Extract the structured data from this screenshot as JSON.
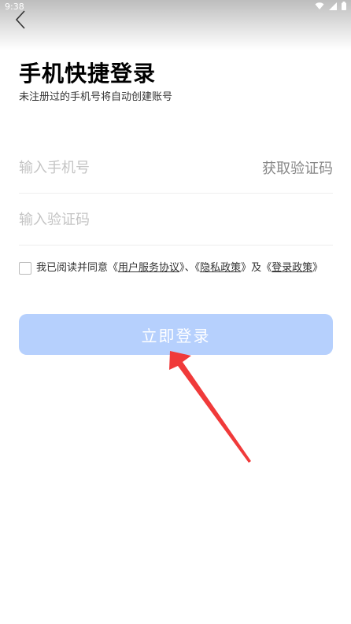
{
  "status": {
    "time": "9:38"
  },
  "page": {
    "title": "手机快捷登录",
    "subtitle": "未注册过的手机号将自动创建账号"
  },
  "phone": {
    "placeholder": "输入手机号",
    "get_code_label": "获取验证码"
  },
  "code": {
    "placeholder": "输入验证码"
  },
  "agreement": {
    "prefix": "我已阅读并同意",
    "open": "《",
    "close": "》",
    "sep": "、",
    "and": "及",
    "user_agreement": "用户服务协议",
    "privacy_policy": "隐私政策",
    "login_policy": "登录政策"
  },
  "login": {
    "label": "立即登录"
  },
  "colors": {
    "button_bg": "#b6d0fd",
    "annotation_arrow": "#f03a3a"
  }
}
